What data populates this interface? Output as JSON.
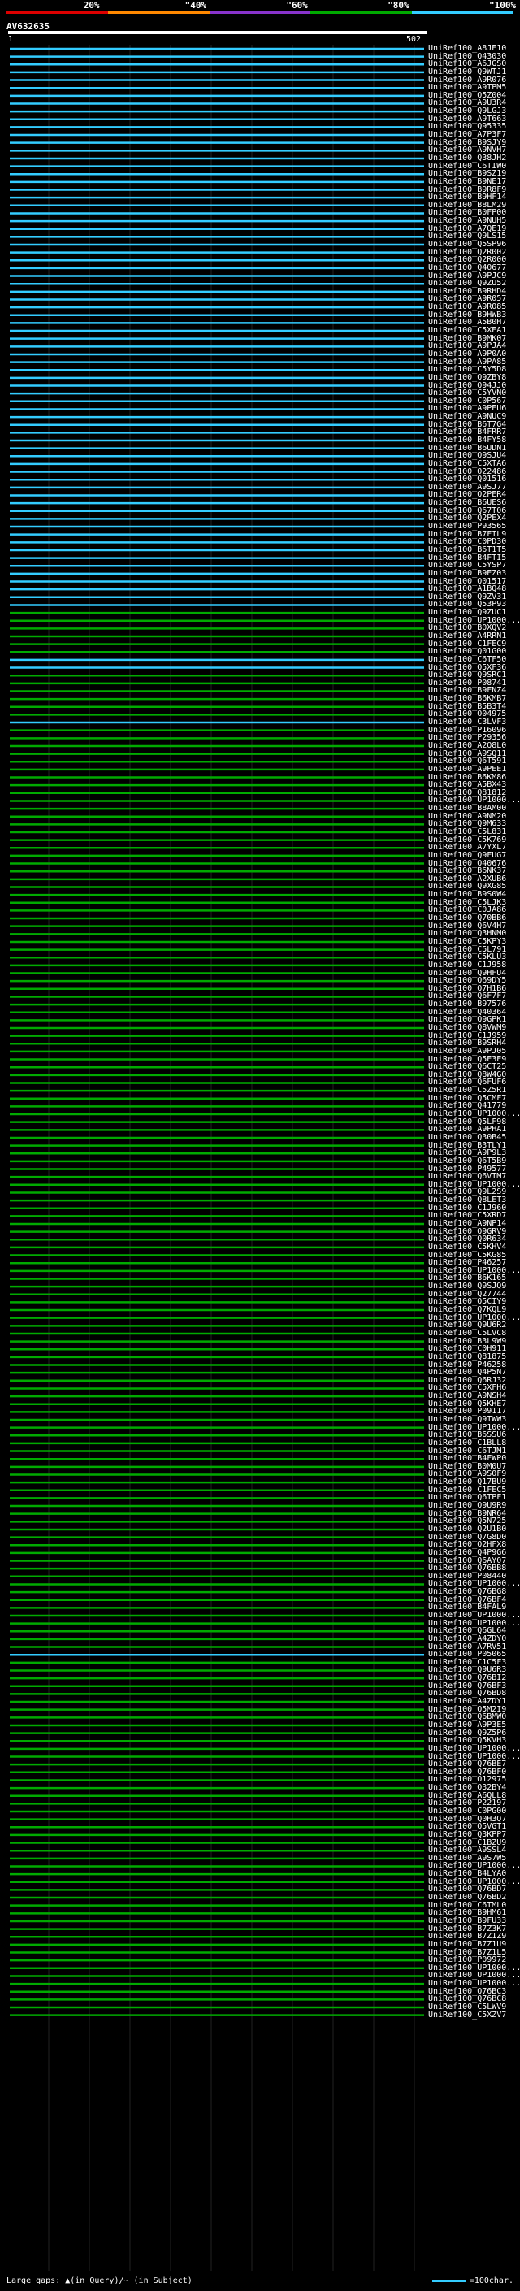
{
  "legend": {
    "labels": [
      "20%",
      "\"40%",
      "\"60%",
      "\"80%",
      "\"100%"
    ],
    "colors": [
      "#dd0000",
      "#ff8800",
      "#8833cc",
      "#00aa00",
      "#33ccff"
    ]
  },
  "query": {
    "name": "AV632635",
    "start": "1",
    "end": "502"
  },
  "hits": [
    {
      "id": "UniRef100_A8JE10",
      "c": "b"
    },
    {
      "id": "UniRef100_Q43030",
      "c": "b"
    },
    {
      "id": "UniRef100_A6JGS0",
      "c": "b"
    },
    {
      "id": "UniRef100_Q9WTJ1",
      "c": "b"
    },
    {
      "id": "UniRef100_A9R076",
      "c": "b"
    },
    {
      "id": "UniRef100_A9TPM5",
      "c": "b"
    },
    {
      "id": "UniRef100_Q5Z004",
      "c": "b"
    },
    {
      "id": "UniRef100_A9U3R4",
      "c": "b"
    },
    {
      "id": "UniRef100_Q9LGJ3",
      "c": "b"
    },
    {
      "id": "UniRef100_A9T663",
      "c": "b"
    },
    {
      "id": "UniRef100_Q95335",
      "c": "b"
    },
    {
      "id": "UniRef100_A7P3F7",
      "c": "b"
    },
    {
      "id": "UniRef100_B9SJY9",
      "c": "b"
    },
    {
      "id": "UniRef100_A9NVH7",
      "c": "b"
    },
    {
      "id": "UniRef100_Q38JH2",
      "c": "b"
    },
    {
      "id": "UniRef100_C6TIW0",
      "c": "b"
    },
    {
      "id": "UniRef100_B9SZ19",
      "c": "b"
    },
    {
      "id": "UniRef100_B9NE17",
      "c": "b"
    },
    {
      "id": "UniRef100_B9R8F9",
      "c": "b"
    },
    {
      "id": "UniRef100_B9HF14",
      "c": "b"
    },
    {
      "id": "UniRef100_B8LM29",
      "c": "b"
    },
    {
      "id": "UniRef100_B0FP00",
      "c": "b"
    },
    {
      "id": "UniRef100_A9NUH5",
      "c": "b"
    },
    {
      "id": "UniRef100_A7QE19",
      "c": "b"
    },
    {
      "id": "UniRef100_Q9LS15",
      "c": "b"
    },
    {
      "id": "UniRef100_Q5SP96",
      "c": "b"
    },
    {
      "id": "UniRef100_Q2R002",
      "c": "b"
    },
    {
      "id": "UniRef100_Q2R000",
      "c": "b"
    },
    {
      "id": "UniRef100_Q40677",
      "c": "b"
    },
    {
      "id": "UniRef100_A9PJC9",
      "c": "b"
    },
    {
      "id": "UniRef100_Q9ZU52",
      "c": "b"
    },
    {
      "id": "UniRef100_B9RHD4",
      "c": "b"
    },
    {
      "id": "UniRef100_A9R057",
      "c": "b"
    },
    {
      "id": "UniRef100_A9R085",
      "c": "b"
    },
    {
      "id": "UniRef100_B9HWB3",
      "c": "b"
    },
    {
      "id": "UniRef100_A5B0H7",
      "c": "b"
    },
    {
      "id": "UniRef100_C5XEA1",
      "c": "b"
    },
    {
      "id": "UniRef100_B9MK07",
      "c": "b"
    },
    {
      "id": "UniRef100_A9PJA4",
      "c": "b"
    },
    {
      "id": "UniRef100_A9P0A0",
      "c": "b"
    },
    {
      "id": "UniRef100_A9PA85",
      "c": "b"
    },
    {
      "id": "UniRef100_C5Y5D8",
      "c": "b"
    },
    {
      "id": "UniRef100_Q9ZBY8",
      "c": "b"
    },
    {
      "id": "UniRef100_Q94JJ0",
      "c": "b"
    },
    {
      "id": "UniRef100_C5YVN0",
      "c": "b"
    },
    {
      "id": "UniRef100_C0P567",
      "c": "b"
    },
    {
      "id": "UniRef100_A9PEU6",
      "c": "b"
    },
    {
      "id": "UniRef100_A9NUC9",
      "c": "b"
    },
    {
      "id": "UniRef100_B6T7G4",
      "c": "b"
    },
    {
      "id": "UniRef100_B4FRR7",
      "c": "b"
    },
    {
      "id": "UniRef100_B4FY58",
      "c": "b"
    },
    {
      "id": "UniRef100_B6UDN1",
      "c": "b"
    },
    {
      "id": "UniRef100_Q9SJU4",
      "c": "b"
    },
    {
      "id": "UniRef100_C5XTA6",
      "c": "b"
    },
    {
      "id": "UniRef100_O22486",
      "c": "b"
    },
    {
      "id": "UniRef100_Q01516",
      "c": "b"
    },
    {
      "id": "UniRef100_A9SJ77",
      "c": "b"
    },
    {
      "id": "UniRef100_Q2PER4",
      "c": "b"
    },
    {
      "id": "UniRef100_B6UES6",
      "c": "b"
    },
    {
      "id": "UniRef100_Q67T06",
      "c": "b"
    },
    {
      "id": "UniRef100_Q2PEX4",
      "c": "b"
    },
    {
      "id": "UniRef100_P93565",
      "c": "b"
    },
    {
      "id": "UniRef100_B7FIL9",
      "c": "b"
    },
    {
      "id": "UniRef100_C0PD30",
      "c": "b"
    },
    {
      "id": "UniRef100_B6T1T5",
      "c": "b"
    },
    {
      "id": "UniRef100_B4FTI5",
      "c": "b"
    },
    {
      "id": "UniRef100_C5YSP7",
      "c": "b"
    },
    {
      "id": "UniRef100_B9EZ03",
      "c": "b"
    },
    {
      "id": "UniRef100_Q01517",
      "c": "b"
    },
    {
      "id": "UniRef100_A1BQ48",
      "c": "b"
    },
    {
      "id": "UniRef100_Q9ZV31",
      "c": "b"
    },
    {
      "id": "UniRef100_Q53P93",
      "c": "b"
    },
    {
      "id": "UniRef100_Q9ZUC1",
      "c": "g"
    },
    {
      "id": "UniRef100_UP1000...",
      "c": "g"
    },
    {
      "id": "UniRef100_B0XQV2",
      "c": "g"
    },
    {
      "id": "UniRef100_A4RRN1",
      "c": "g"
    },
    {
      "id": "UniRef100_C1FEC9",
      "c": "g"
    },
    {
      "id": "UniRef100_Q01G00",
      "c": "g"
    },
    {
      "id": "UniRef100_C6TF50",
      "c": "b"
    },
    {
      "id": "UniRef100_Q5XF36",
      "c": "b"
    },
    {
      "id": "UniRef100_Q9SRC1",
      "c": "g"
    },
    {
      "id": "UniRef100_P08741",
      "c": "g"
    },
    {
      "id": "UniRef100_B9FNZ4",
      "c": "g"
    },
    {
      "id": "UniRef100_B6KMB7",
      "c": "g"
    },
    {
      "id": "UniRef100_B5B3T4",
      "c": "g"
    },
    {
      "id": "UniRef100_O04975",
      "c": "g"
    },
    {
      "id": "UniRef100_C3LVF3",
      "c": "b"
    },
    {
      "id": "UniRef100_P16096",
      "c": "g"
    },
    {
      "id": "UniRef100_P29356",
      "c": "g"
    },
    {
      "id": "UniRef100_A2Q8L0",
      "c": "g"
    },
    {
      "id": "UniRef100_A9SQ11",
      "c": "g"
    },
    {
      "id": "UniRef100_Q6T591",
      "c": "g"
    },
    {
      "id": "UniRef100_A9PEE1",
      "c": "g"
    },
    {
      "id": "UniRef100_B6KM86",
      "c": "g"
    },
    {
      "id": "UniRef100_A5BX43",
      "c": "g"
    },
    {
      "id": "UniRef100_Q81812",
      "c": "g"
    },
    {
      "id": "UniRef100_UP1000...",
      "c": "g"
    },
    {
      "id": "UniRef100_B8AM00",
      "c": "g"
    },
    {
      "id": "UniRef100_A9NM20",
      "c": "g"
    },
    {
      "id": "UniRef100_Q9M633",
      "c": "g"
    },
    {
      "id": "UniRef100_C5L831",
      "c": "g"
    },
    {
      "id": "UniRef100_C5K769",
      "c": "g"
    },
    {
      "id": "UniRef100_A7YXL7",
      "c": "g"
    },
    {
      "id": "UniRef100_Q9FUG7",
      "c": "g"
    },
    {
      "id": "UniRef100_Q40676",
      "c": "g"
    },
    {
      "id": "UniRef100_B6NK37",
      "c": "g"
    },
    {
      "id": "UniRef100_A2XUB6",
      "c": "g"
    },
    {
      "id": "UniRef100_Q9XG85",
      "c": "g"
    },
    {
      "id": "UniRef100_B9S0W4",
      "c": "g"
    },
    {
      "id": "UniRef100_C5LJK3",
      "c": "g"
    },
    {
      "id": "UniRef100_C0JA86",
      "c": "g"
    },
    {
      "id": "UniRef100_Q70BB6",
      "c": "g"
    },
    {
      "id": "UniRef100_Q6V4H7",
      "c": "g"
    },
    {
      "id": "UniRef100_Q3HNM0",
      "c": "g"
    },
    {
      "id": "UniRef100_C5KPY3",
      "c": "g"
    },
    {
      "id": "UniRef100_C5L791",
      "c": "g"
    },
    {
      "id": "UniRef100_C5KLU3",
      "c": "g"
    },
    {
      "id": "UniRef100_C1J958",
      "c": "g"
    },
    {
      "id": "UniRef100_Q9HFU4",
      "c": "g"
    },
    {
      "id": "UniRef100_Q69DY5",
      "c": "g"
    },
    {
      "id": "UniRef100_Q7H1B6",
      "c": "g"
    },
    {
      "id": "UniRef100_Q6F7F7",
      "c": "g"
    },
    {
      "id": "UniRef100_B97576",
      "c": "g"
    },
    {
      "id": "UniRef100_Q40364",
      "c": "g"
    },
    {
      "id": "UniRef100_Q9GPK1",
      "c": "g"
    },
    {
      "id": "UniRef100_Q8VWM9",
      "c": "g"
    },
    {
      "id": "UniRef100_C1J959",
      "c": "g"
    },
    {
      "id": "UniRef100_B9SRH4",
      "c": "g"
    },
    {
      "id": "UniRef100_A9PJ05",
      "c": "g"
    },
    {
      "id": "UniRef100_Q5E3E9",
      "c": "g"
    },
    {
      "id": "UniRef100_Q6CT25",
      "c": "g"
    },
    {
      "id": "UniRef100_Q8W4G0",
      "c": "g"
    },
    {
      "id": "UniRef100_Q6FUF6",
      "c": "g"
    },
    {
      "id": "UniRef100_C5Z5R1",
      "c": "g"
    },
    {
      "id": "UniRef100_Q5CMF7",
      "c": "g"
    },
    {
      "id": "UniRef100_Q41779",
      "c": "g"
    },
    {
      "id": "UniRef100_UP1000...",
      "c": "g"
    },
    {
      "id": "UniRef100_Q5LF98",
      "c": "g"
    },
    {
      "id": "UniRef100_A9PHA1",
      "c": "g"
    },
    {
      "id": "UniRef100_Q30B45",
      "c": "g"
    },
    {
      "id": "UniRef100_B3TLY1",
      "c": "g"
    },
    {
      "id": "UniRef100_A9P9L3",
      "c": "g"
    },
    {
      "id": "UniRef100_Q6T5B9",
      "c": "g"
    },
    {
      "id": "UniRef100_P49577",
      "c": "g"
    },
    {
      "id": "UniRef100_Q6VTM7",
      "c": "g"
    },
    {
      "id": "UniRef100_UP1000...",
      "c": "g"
    },
    {
      "id": "UniRef100_Q9L2S9",
      "c": "g"
    },
    {
      "id": "UniRef100_Q8LET3",
      "c": "g"
    },
    {
      "id": "UniRef100_C1J960",
      "c": "g"
    },
    {
      "id": "UniRef100_C5XRD7",
      "c": "g"
    },
    {
      "id": "UniRef100_A9NP14",
      "c": "g"
    },
    {
      "id": "UniRef100_Q9GRV9",
      "c": "g"
    },
    {
      "id": "UniRef100_Q0R634",
      "c": "g"
    },
    {
      "id": "UniRef100_C5KHV4",
      "c": "g"
    },
    {
      "id": "UniRef100_C5KG85",
      "c": "g"
    },
    {
      "id": "UniRef100_P46257",
      "c": "g"
    },
    {
      "id": "UniRef100_UP1000...",
      "c": "g"
    },
    {
      "id": "UniRef100_B6K165",
      "c": "g"
    },
    {
      "id": "UniRef100_Q9SJQ9",
      "c": "g"
    },
    {
      "id": "UniRef100_Q27744",
      "c": "g"
    },
    {
      "id": "UniRef100_Q5CIY9",
      "c": "g"
    },
    {
      "id": "UniRef100_Q7KQL9",
      "c": "g"
    },
    {
      "id": "UniRef100_UP1000...",
      "c": "g"
    },
    {
      "id": "UniRef100_Q9U6R2",
      "c": "g"
    },
    {
      "id": "UniRef100_C5LVC8",
      "c": "g"
    },
    {
      "id": "UniRef100_B3L9W9",
      "c": "g"
    },
    {
      "id": "UniRef100_C0H911",
      "c": "g"
    },
    {
      "id": "UniRef100_Q81875",
      "c": "g"
    },
    {
      "id": "UniRef100_P46258",
      "c": "g"
    },
    {
      "id": "UniRef100_Q4P5N7",
      "c": "g"
    },
    {
      "id": "UniRef100_Q6RJ32",
      "c": "g"
    },
    {
      "id": "UniRef100_C5XFH6",
      "c": "g"
    },
    {
      "id": "UniRef100_A9NSH4",
      "c": "g"
    },
    {
      "id": "UniRef100_Q5KHE7",
      "c": "g"
    },
    {
      "id": "UniRef100_P09117",
      "c": "g"
    },
    {
      "id": "UniRef100_Q9TWW3",
      "c": "g"
    },
    {
      "id": "UniRef100_UP1000...",
      "c": "g"
    },
    {
      "id": "UniRef100_B6SSU6",
      "c": "g"
    },
    {
      "id": "UniRef100_C1BLL8",
      "c": "g"
    },
    {
      "id": "UniRef100_C6TJM1",
      "c": "g"
    },
    {
      "id": "UniRef100_B4FWP0",
      "c": "g"
    },
    {
      "id": "UniRef100_B0M0U7",
      "c": "g"
    },
    {
      "id": "UniRef100_A9S0F9",
      "c": "g"
    },
    {
      "id": "UniRef100_Q17BU9",
      "c": "g"
    },
    {
      "id": "UniRef100_C1FEC5",
      "c": "g"
    },
    {
      "id": "UniRef100_Q6TPF1",
      "c": "g"
    },
    {
      "id": "UniRef100_Q9U9R9",
      "c": "g"
    },
    {
      "id": "UniRef100_B9NR64",
      "c": "g"
    },
    {
      "id": "UniRef100_Q5N725",
      "c": "g"
    },
    {
      "id": "UniRef100_Q2U1B0",
      "c": "g"
    },
    {
      "id": "UniRef100_Q7G8D0",
      "c": "g"
    },
    {
      "id": "UniRef100_Q2HFX8",
      "c": "g"
    },
    {
      "id": "UniRef100_Q4P9G6",
      "c": "g"
    },
    {
      "id": "UniRef100_Q6AY07",
      "c": "g"
    },
    {
      "id": "UniRef100_Q76BB8",
      "c": "g"
    },
    {
      "id": "UniRef100_P08440",
      "c": "g"
    },
    {
      "id": "UniRef100_UP1000...",
      "c": "g"
    },
    {
      "id": "UniRef100_Q76BG8",
      "c": "g"
    },
    {
      "id": "UniRef100_Q76BF4",
      "c": "g"
    },
    {
      "id": "UniRef100_B4FAL9",
      "c": "g"
    },
    {
      "id": "UniRef100_UP1000...",
      "c": "g"
    },
    {
      "id": "UniRef100_UP1000...",
      "c": "g"
    },
    {
      "id": "UniRef100_Q6GL64",
      "c": "g"
    },
    {
      "id": "UniRef100_A4ZDY0",
      "c": "g"
    },
    {
      "id": "UniRef100_A7RV51",
      "c": "g"
    },
    {
      "id": "UniRef100_P05065",
      "c": "b"
    },
    {
      "id": "UniRef100_C1C5F3",
      "c": "g"
    },
    {
      "id": "UniRef100_Q9U6R3",
      "c": "g"
    },
    {
      "id": "UniRef100_Q76BI2",
      "c": "g"
    },
    {
      "id": "UniRef100_Q76BF3",
      "c": "g"
    },
    {
      "id": "UniRef100_Q76BD8",
      "c": "g"
    },
    {
      "id": "UniRef100_A4ZDY1",
      "c": "g"
    },
    {
      "id": "UniRef100_Q5M2I9",
      "c": "g"
    },
    {
      "id": "UniRef100_Q6BMW0",
      "c": "g"
    },
    {
      "id": "UniRef100_A9P3E5",
      "c": "g"
    },
    {
      "id": "UniRef100_Q9Z5P6",
      "c": "g"
    },
    {
      "id": "UniRef100_Q5KVH3",
      "c": "g"
    },
    {
      "id": "UniRef100_UP1000...",
      "c": "g"
    },
    {
      "id": "UniRef100_UP1000...",
      "c": "g"
    },
    {
      "id": "UniRef100_Q76BE7",
      "c": "g"
    },
    {
      "id": "UniRef100_Q76BF0",
      "c": "g"
    },
    {
      "id": "UniRef100_O12975",
      "c": "g"
    },
    {
      "id": "UniRef100_Q32BY4",
      "c": "g"
    },
    {
      "id": "UniRef100_A6QLL8",
      "c": "g"
    },
    {
      "id": "UniRef100_P22197",
      "c": "g"
    },
    {
      "id": "UniRef100_C0PG00",
      "c": "g"
    },
    {
      "id": "UniRef100_Q0H3Q7",
      "c": "g"
    },
    {
      "id": "UniRef100_Q5VGT1",
      "c": "g"
    },
    {
      "id": "UniRef100_Q3KPP7",
      "c": "g"
    },
    {
      "id": "UniRef100_C1BZU9",
      "c": "g"
    },
    {
      "id": "UniRef100_A9SSL4",
      "c": "g"
    },
    {
      "id": "UniRef100_A9S7W5",
      "c": "g"
    },
    {
      "id": "UniRef100_UP1000...",
      "c": "g"
    },
    {
      "id": "UniRef100_B4LYA0",
      "c": "g"
    },
    {
      "id": "UniRef100_UP1000...",
      "c": "g"
    },
    {
      "id": "UniRef100_Q76BD7",
      "c": "g"
    },
    {
      "id": "UniRef100_Q76BD2",
      "c": "g"
    },
    {
      "id": "UniRef100_C6TML0",
      "c": "g"
    },
    {
      "id": "UniRef100_B9HM61",
      "c": "g"
    },
    {
      "id": "UniRef100_B9FU33",
      "c": "g"
    },
    {
      "id": "UniRef100_B7Z3K7",
      "c": "g"
    },
    {
      "id": "UniRef100_B7Z1Z9",
      "c": "g"
    },
    {
      "id": "UniRef100_B7Z1U9",
      "c": "g"
    },
    {
      "id": "UniRef100_B7Z1L5",
      "c": "g"
    },
    {
      "id": "UniRef100_P09972",
      "c": "g"
    },
    {
      "id": "UniRef100_UP1000...",
      "c": "g"
    },
    {
      "id": "UniRef100_UP1000...",
      "c": "g"
    },
    {
      "id": "UniRef100_UP1000...",
      "c": "g"
    },
    {
      "id": "UniRef100_Q76BC3",
      "c": "g"
    },
    {
      "id": "UniRef100_Q76BC8",
      "c": "g"
    },
    {
      "id": "UniRef100_C5LWV9",
      "c": "g"
    },
    {
      "id": "UniRef100_C5XZV7",
      "c": "g"
    }
  ],
  "footer": {
    "left": "Large gaps: ▲(in Query)/~ (in Subject)",
    "right": "=100char."
  }
}
